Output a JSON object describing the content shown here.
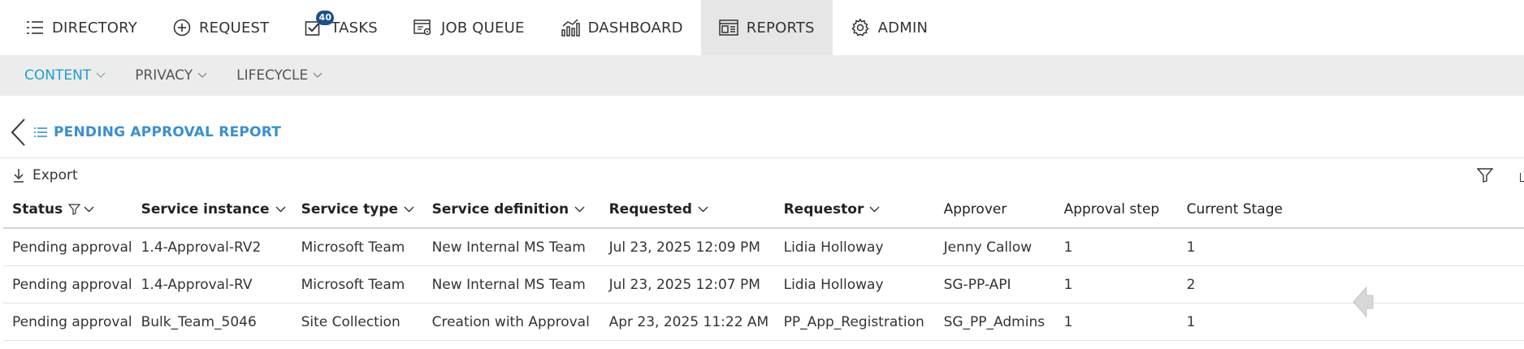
{
  "topnav": {
    "items": [
      {
        "label": "DIRECTORY",
        "icon": "list-icon"
      },
      {
        "label": "REQUEST",
        "icon": "plus-circle-icon"
      },
      {
        "label": "TASKS",
        "icon": "checkbox-icon",
        "badge": "40"
      },
      {
        "label": "JOB QUEUE",
        "icon": "job-queue-icon"
      },
      {
        "label": "DASHBOARD",
        "icon": "bar-chart-icon"
      },
      {
        "label": "REPORTS",
        "icon": "report-icon",
        "active": true
      },
      {
        "label": "ADMIN",
        "icon": "gear-icon"
      }
    ]
  },
  "subnav": {
    "items": [
      {
        "label": "CONTENT",
        "active": true
      },
      {
        "label": "PRIVACY"
      },
      {
        "label": "LIFECYCLE"
      }
    ]
  },
  "page": {
    "title": "PENDING APPROVAL REPORT",
    "export_label": "Export"
  },
  "table": {
    "columns": [
      "Status",
      "Service instance",
      "Service type",
      "Service definition",
      "Requested",
      "Requestor",
      "Approver",
      "Approval step",
      "Current Stage"
    ],
    "rows": [
      [
        "Pending approval",
        "1.4-Approval-RV2",
        "Microsoft Team",
        "New Internal MS Team",
        "Jul 23, 2025 12:09 PM",
        "Lidia Holloway",
        "Jenny Callow",
        "1",
        "1"
      ],
      [
        "Pending approval",
        "1.4-Approval-RV",
        "Microsoft Team",
        "New Internal MS Team",
        "Jul 23, 2025 12:07 PM",
        "Lidia Holloway",
        "SG-PP-API",
        "1",
        "2"
      ],
      [
        "Pending approval",
        "Bulk_Team_5046",
        "Site Collection",
        "Creation with Approval",
        "Apr 23, 2025 11:22 AM",
        "PP_App_Registration",
        "SG_PP_Admins",
        "1",
        "1"
      ]
    ]
  },
  "colors": {
    "accent": "#3a8fcf",
    "subnav_active": "#1f9fc9",
    "badge": "#1c4f8a",
    "subnav_bg": "#ececec",
    "active_tab_bg": "#e6e6e6"
  }
}
